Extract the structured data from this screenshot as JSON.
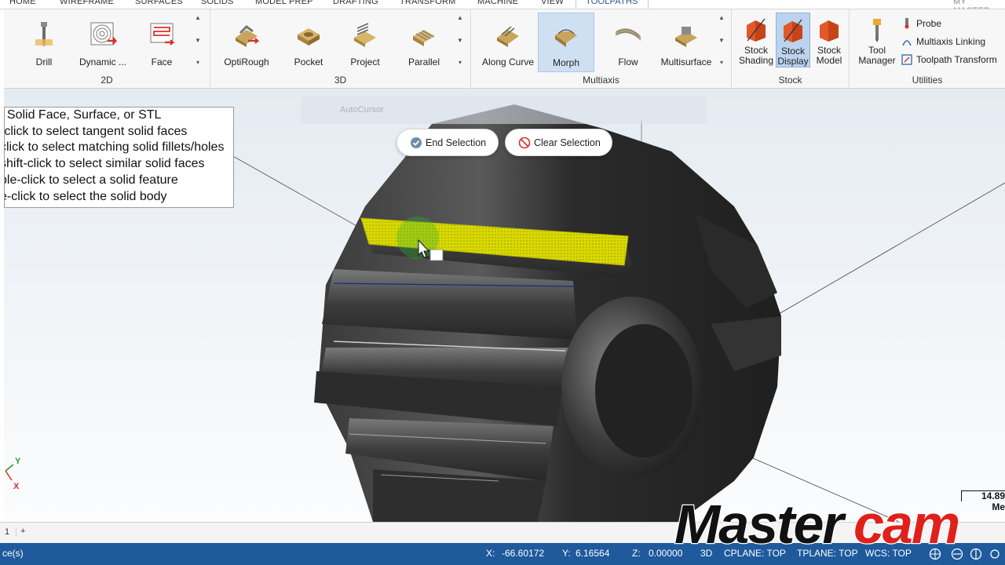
{
  "tabs": [
    {
      "label": "HOME"
    },
    {
      "label": "WIREFRAME"
    },
    {
      "label": "SURFACES"
    },
    {
      "label": "SOLIDS"
    },
    {
      "label": "MODEL PREP"
    },
    {
      "label": "DRAFTING"
    },
    {
      "label": "TRANSFORM"
    },
    {
      "label": "MACHINE"
    },
    {
      "label": "VIEW"
    },
    {
      "label": "TOOLPATHS"
    }
  ],
  "active_tab": "TOOLPATHS",
  "account_label": "MY MASTER",
  "ribbon": {
    "group_2d": {
      "label": "2D",
      "buttons": [
        {
          "label": "Drill",
          "icon": "drill-icon"
        },
        {
          "label": "Dynamic ...",
          "icon": "dynamic-mill-icon"
        },
        {
          "label": "Face",
          "icon": "face-icon"
        }
      ]
    },
    "group_3d": {
      "label": "3D",
      "buttons": [
        {
          "label": "OptiRough",
          "icon": "optirough-icon"
        },
        {
          "label": "Pocket",
          "icon": "pocket-icon"
        },
        {
          "label": "Project",
          "icon": "project-icon"
        },
        {
          "label": "Parallel",
          "icon": "parallel-icon"
        }
      ]
    },
    "group_multiaxis": {
      "label": "Multiaxis",
      "buttons": [
        {
          "label": "Along Curve",
          "icon": "along-curve-icon"
        },
        {
          "label": "Morph",
          "icon": "morph-icon"
        },
        {
          "label": "Flow",
          "icon": "flow-icon"
        },
        {
          "label": "Multisurface",
          "icon": "multisurface-icon"
        }
      ]
    },
    "group_stock": {
      "label": "Stock",
      "buttons": [
        {
          "line1": "Stock",
          "line2": "Shading"
        },
        {
          "line1": "Stock",
          "line2": "Display"
        },
        {
          "line1": "Stock",
          "line2": "Model"
        }
      ]
    },
    "group_utilities": {
      "label": "Utilities",
      "tool_manager": {
        "line1": "Tool",
        "line2": "Manager"
      },
      "items": [
        {
          "label": "Probe"
        },
        {
          "label": "Multiaxis Linking"
        },
        {
          "label": "Toolpath Transform"
        }
      ]
    }
  },
  "prompt_lines": [
    "t Solid Face, Surface, or STL",
    "-click to select tangent solid faces",
    "click to select matching solid fillets/holes",
    "shift-click to select similar solid faces",
    "ble-click to select a solid feature",
    "e-click to select the solid body"
  ],
  "selection": {
    "end_label": "End Selection",
    "clear_label": "Clear Selection"
  },
  "autocursor_label": "AutoCursor",
  "triad": {
    "y": "Y",
    "x": "X"
  },
  "scale": {
    "value": "14.89",
    "unit": "Me"
  },
  "sheet": {
    "tab": "1",
    "add": "+"
  },
  "status": {
    "left": "ce(s)",
    "x_label": "X:",
    "x_value": "-66.60172",
    "y_label": "Y:",
    "y_value": "6.16564",
    "z_label": "Z:",
    "z_value": "0.00000",
    "mode": "3D",
    "cplane": "CPLANE: TOP",
    "tplane": "TPLANE: TOP",
    "wcs": "WCS: TOP"
  },
  "brand": "Mastercam",
  "colors": {
    "status_bar": "#1e5a9c",
    "selected_face": "#d9d900",
    "logo_red": "#e0201b",
    "selected_button": "#cfe0f3"
  }
}
